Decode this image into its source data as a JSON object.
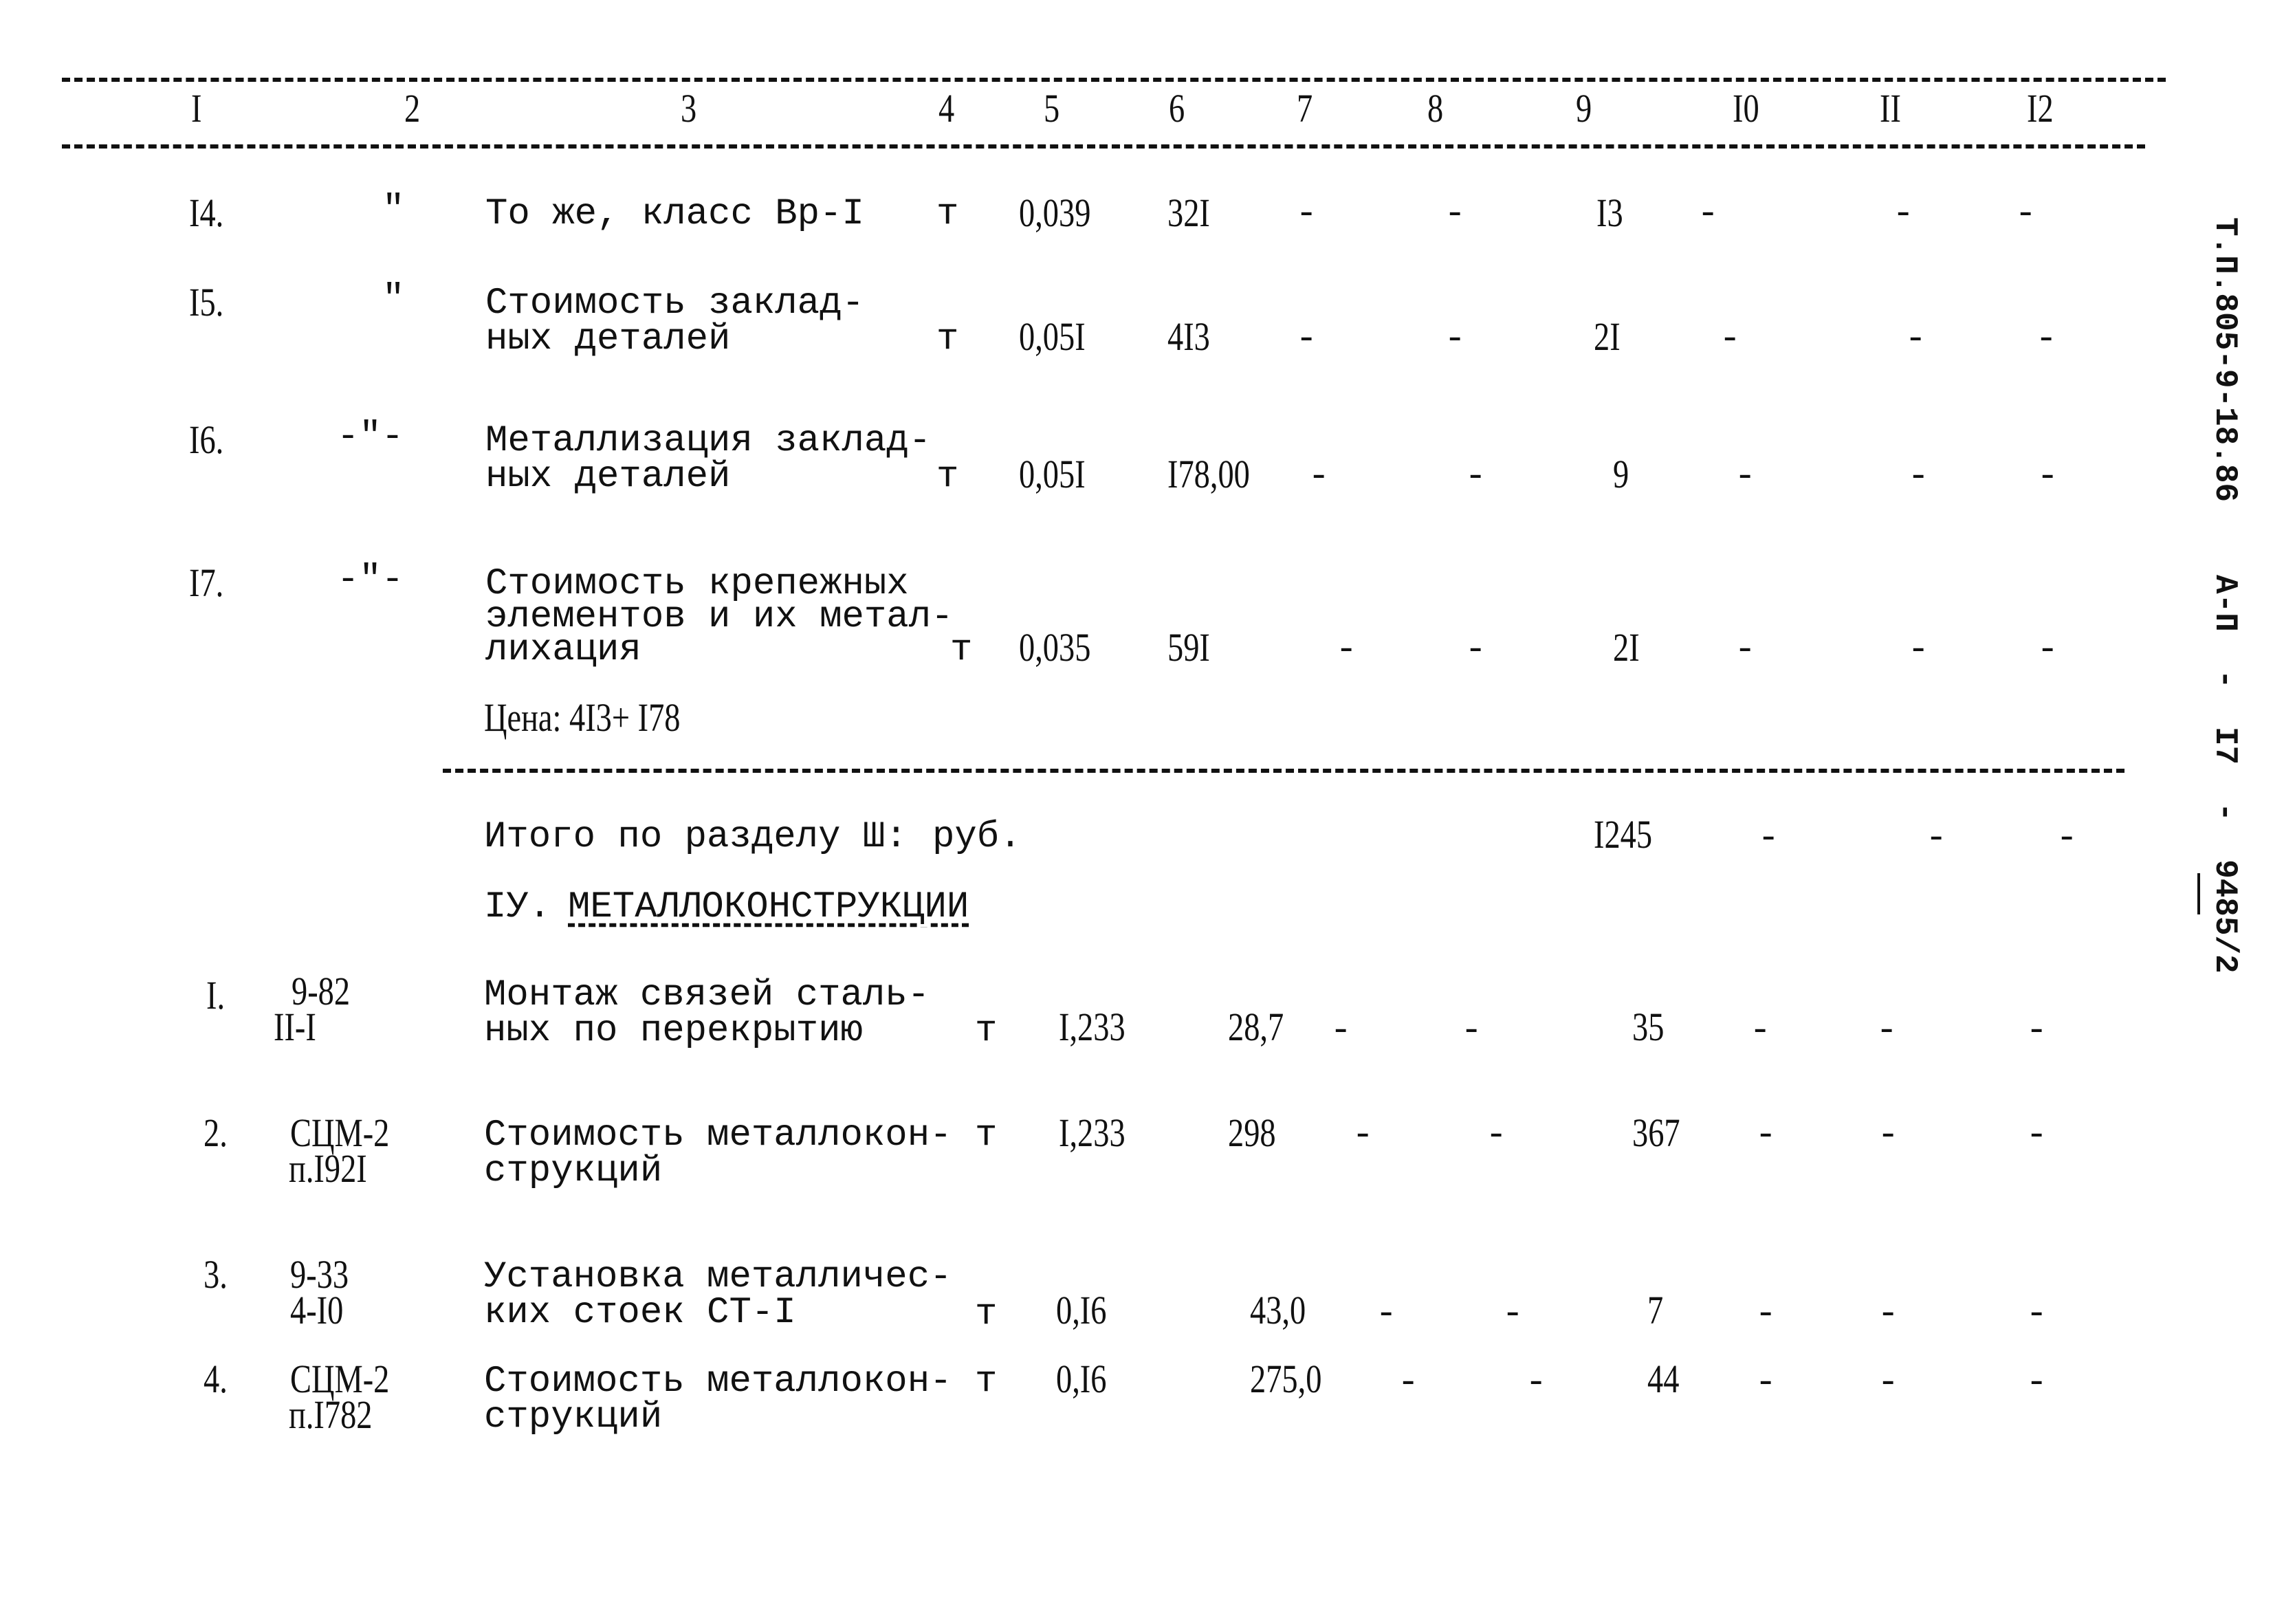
{
  "header": {
    "columns": [
      "I",
      "2",
      "3",
      "4",
      "5",
      "6",
      "7",
      "8",
      "9",
      "I0",
      "II",
      "I2"
    ]
  },
  "section3_rows": [
    {
      "no": "I4.",
      "code": "\"",
      "desc": [
        "То же, класс Вр-I"
      ],
      "unit": "т",
      "qty": "0,039",
      "price": "32I",
      "c7": "-",
      "c8": "-",
      "c9": "I3",
      "c10": "-",
      "c11": "-",
      "c12": "-"
    },
    {
      "no": "I5.",
      "code": "\"",
      "desc": [
        "Стоимость заклад-",
        "ных деталей"
      ],
      "unit": "т",
      "qty": "0,05I",
      "price": "4I3",
      "c7": "-",
      "c8": "-",
      "c9": "2I",
      "c10": "-",
      "c11": "-",
      "c12": "-"
    },
    {
      "no": "I6.",
      "code": "-\"-",
      "desc": [
        "Металлизация заклад-",
        "ных деталей"
      ],
      "unit": "т",
      "qty": "0,05I",
      "price": "I78,00",
      "c7": "-",
      "c8": "-",
      "c9": "9",
      "c10": "-",
      "c11": "-",
      "c12": "-"
    },
    {
      "no": "I7.",
      "code": "-\"-",
      "desc": [
        "Стоимость крепежных",
        "элементов и их метал-",
        "лихация"
      ],
      "unit": "т",
      "qty": "0,035",
      "price": "59I",
      "c7": "-",
      "c8": "-",
      "c9": "2I",
      "c10": "-",
      "c11": "-",
      "c12": "-"
    }
  ],
  "price_note": "Цена: 4I3+ I78",
  "section3_total": {
    "label": "Итого по разделу Ш:",
    "unit": "руб.",
    "c9": "I245",
    "c10": "-",
    "c11": "-",
    "c12": "-"
  },
  "section4_title": {
    "prefix": "IУ.",
    "title": "МЕТАЛЛОКОНСТРУКЦИИ"
  },
  "section4_rows": [
    {
      "no": "I.",
      "code": [
        "9-82",
        "II-I"
      ],
      "desc": [
        "Монтаж связей сталь-",
        "ных по перекрытию"
      ],
      "unit": "т",
      "qty": "I,233",
      "price": "28,7",
      "c7": "-",
      "c8": "-",
      "c9": "35",
      "c10": "-",
      "c11": "-",
      "c12": "-"
    },
    {
      "no": "2.",
      "code": [
        "СЦМ-2",
        "п.I92I"
      ],
      "desc": [
        "Стоимость металлокон-",
        "струкций"
      ],
      "unit": "т",
      "qty": "I,233",
      "price": "298",
      "c7": "-",
      "c8": "-",
      "c9": "367",
      "c10": "-",
      "c11": "-",
      "c12": "-"
    },
    {
      "no": "3.",
      "code": [
        "9-33",
        "4-I0"
      ],
      "desc": [
        "Установка металличес-",
        "ких стоек СТ-I"
      ],
      "unit": "т",
      "qty": "0,I6",
      "price": "43,0",
      "c7": "-",
      "c8": "-",
      "c9": "7",
      "c10": "-",
      "c11": "-",
      "c12": "-"
    },
    {
      "no": "4.",
      "code": [
        "СЦМ-2",
        "п.I782"
      ],
      "desc": [
        "Стоимость металлокон-",
        "струкций"
      ],
      "unit": "т",
      "qty": "0,I6",
      "price": "275,0",
      "c7": "-",
      "c8": "-",
      "c9": "44",
      "c10": "-",
      "c11": "-",
      "c12": "-"
    }
  ],
  "side_stamp": {
    "doc_code": "Т.П.805-9-18.86",
    "sheet": "А-П  -  I7  -  9485/2"
  }
}
